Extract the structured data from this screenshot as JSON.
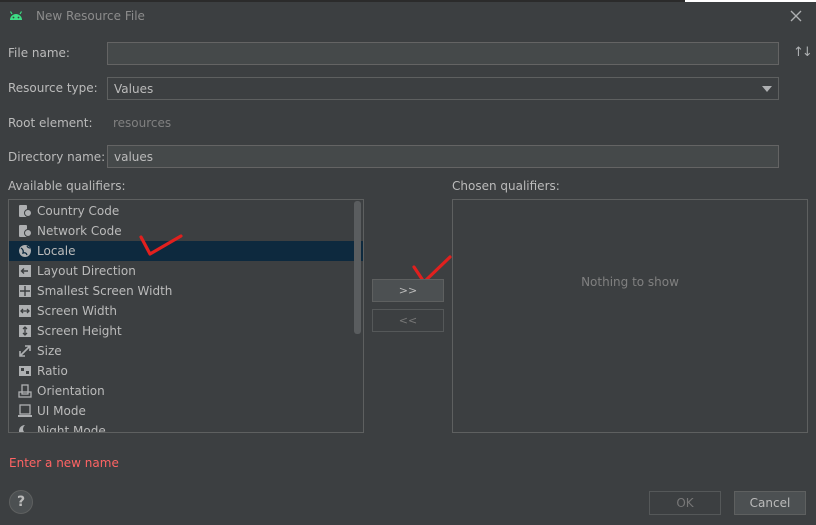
{
  "window": {
    "title": "New Resource File"
  },
  "form": {
    "file_name_label": "File name:",
    "file_name_value": "",
    "sort_icon_glyph": "↑↓",
    "resource_type_label": "Resource type:",
    "resource_type_value": "Values",
    "root_element_label": "Root element:",
    "root_element_value": "resources",
    "directory_name_label": "Directory name:",
    "directory_name_value": "values"
  },
  "qualifiers": {
    "available_label": "Available qualifiers:",
    "chosen_label": "Chosen qualifiers:",
    "items": [
      {
        "label": "Country Code",
        "icon": "country-code-icon"
      },
      {
        "label": "Network Code",
        "icon": "network-code-icon"
      },
      {
        "label": "Locale",
        "icon": "globe-icon"
      },
      {
        "label": "Layout Direction",
        "icon": "layout-direction-icon"
      },
      {
        "label": "Smallest Screen Width",
        "icon": "smallest-width-icon"
      },
      {
        "label": "Screen Width",
        "icon": "screen-width-icon"
      },
      {
        "label": "Screen Height",
        "icon": "screen-height-icon"
      },
      {
        "label": "Size",
        "icon": "size-icon"
      },
      {
        "label": "Ratio",
        "icon": "ratio-icon"
      },
      {
        "label": "Orientation",
        "icon": "orientation-icon"
      },
      {
        "label": "UI Mode",
        "icon": "ui-mode-icon"
      },
      {
        "label": "Night Mode",
        "icon": "night-mode-icon"
      }
    ],
    "selected": "Locale",
    "add_button": ">>",
    "remove_button": "<<",
    "empty_text": "Nothing to show"
  },
  "footer": {
    "error": "Enter a new name",
    "help": "?",
    "ok": "OK",
    "cancel": "Cancel"
  },
  "colors": {
    "background": "#3c3f41",
    "selection": "#0d293e",
    "error": "#ff6464",
    "annotation": "#e0201e"
  }
}
